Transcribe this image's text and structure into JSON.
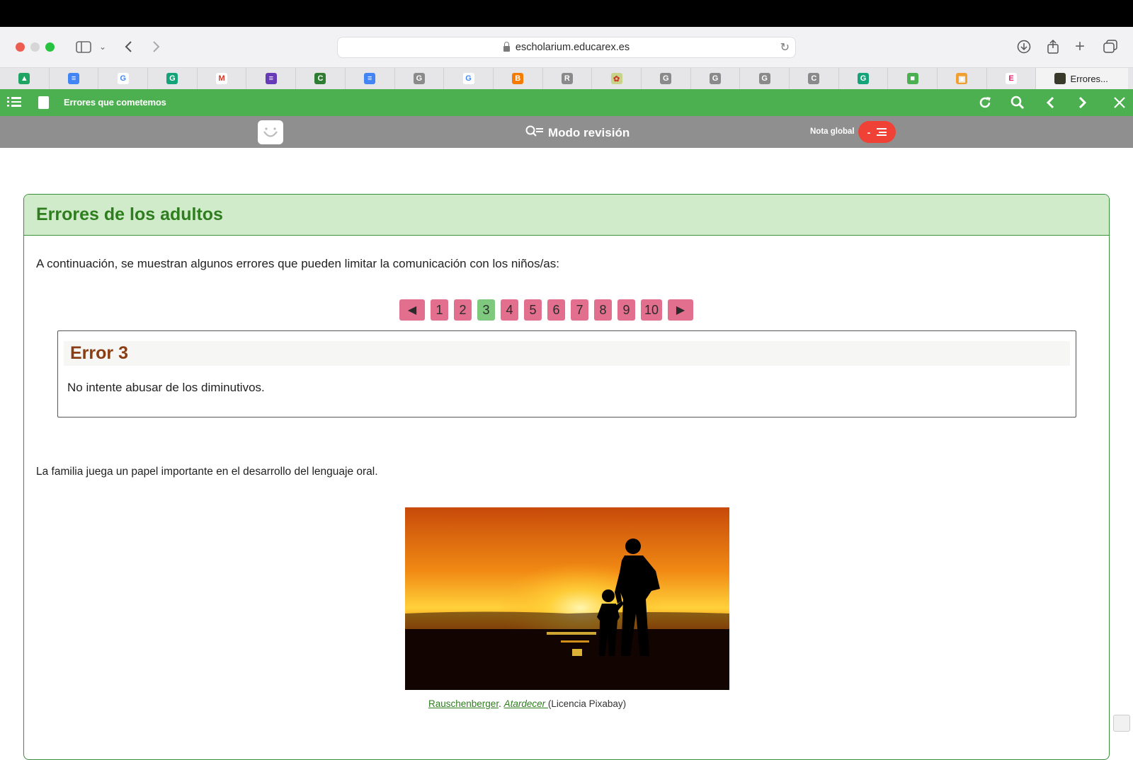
{
  "browser": {
    "url": "escholarium.educarex.es",
    "active_tab_label": "Errores...",
    "favicons": [
      {
        "name": "drive",
        "color": "#1fa463",
        "glyph": "▲"
      },
      {
        "name": "docs",
        "color": "#4285f4",
        "glyph": "≡"
      },
      {
        "name": "google",
        "color": "#ffffff",
        "glyph": "G"
      },
      {
        "name": "grammarly",
        "color": "#15a37a",
        "glyph": "G"
      },
      {
        "name": "gmail",
        "color": "#ffffff",
        "glyph": "M"
      },
      {
        "name": "forms",
        "color": "#673ab7",
        "glyph": "≡"
      },
      {
        "name": "classroom",
        "color": "#2e7d32",
        "glyph": "C"
      },
      {
        "name": "docs",
        "color": "#4285f4",
        "glyph": "≡"
      },
      {
        "name": "g-gray",
        "color": "#8a8a8a",
        "glyph": "G"
      },
      {
        "name": "google",
        "color": "#ffffff",
        "glyph": "G"
      },
      {
        "name": "blogger",
        "color": "#f57c00",
        "glyph": "B"
      },
      {
        "name": "r-gray",
        "color": "#8a8a8a",
        "glyph": "R"
      },
      {
        "name": "leaf",
        "color": "#c8d48a",
        "glyph": "✿"
      },
      {
        "name": "g-gray",
        "color": "#8a8a8a",
        "glyph": "G"
      },
      {
        "name": "g-gray",
        "color": "#8a8a8a",
        "glyph": "G"
      },
      {
        "name": "g-gray",
        "color": "#8a8a8a",
        "glyph": "G"
      },
      {
        "name": "c-gray",
        "color": "#8a8a8a",
        "glyph": "C"
      },
      {
        "name": "grammarly",
        "color": "#15a37a",
        "glyph": "G"
      },
      {
        "name": "blocks",
        "color": "#4caf50",
        "glyph": "■"
      },
      {
        "name": "tool",
        "color": "#f0a030",
        "glyph": "▣"
      },
      {
        "name": "e",
        "color": "#ffffff",
        "glyph": "E"
      }
    ]
  },
  "appbar": {
    "title": "Errores que cometemos",
    "accent": "#4caf50"
  },
  "review": {
    "mode_label": "Modo revisión",
    "nota_label": "Nota global",
    "nota_value": "-"
  },
  "card": {
    "title": "Errores de los adultos",
    "intro": "A continuación, se muestran algunos errores que pueden limitar la comunicación con los niños/as:",
    "pager": {
      "prev": "◀",
      "next": "▶",
      "pages": [
        "1",
        "2",
        "3",
        "4",
        "5",
        "6",
        "7",
        "8",
        "9",
        "10"
      ],
      "current": "3"
    },
    "error": {
      "title": "Error 3",
      "text": "No intente abusar de los diminutivos."
    },
    "family_text": "La familia juega un papel importante en el desarrollo del lenguaje oral.",
    "caption": {
      "author": "Rauschenberger",
      "sep": ". ",
      "work": "Atardecer ",
      "license": "(Licencia Pixabay)"
    }
  }
}
